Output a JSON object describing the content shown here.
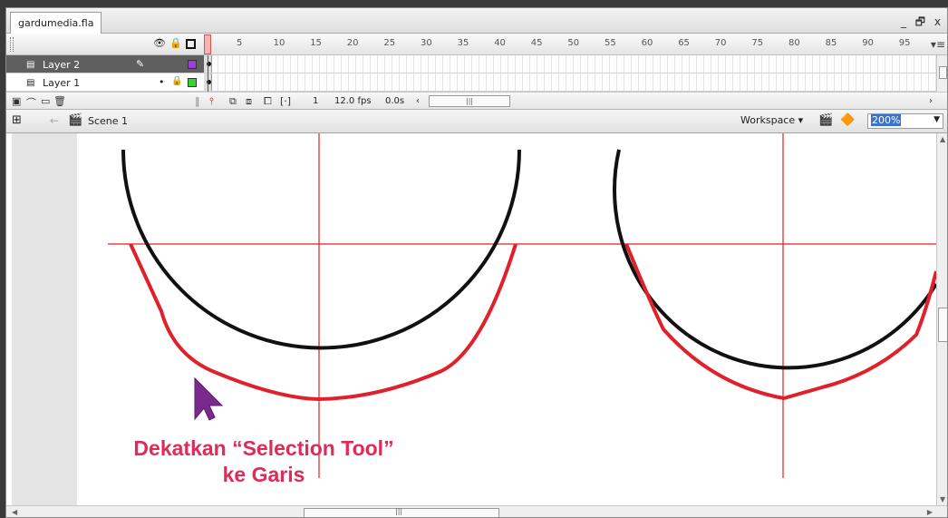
{
  "document": {
    "tab_label": "gardumedia.fla"
  },
  "window_controls": {
    "minimize": "_",
    "restore": "🗗",
    "close": "x"
  },
  "timeline": {
    "frame_numbers": [
      "5",
      "10",
      "15",
      "20",
      "25",
      "30",
      "35",
      "40",
      "45",
      "50",
      "55",
      "60",
      "65",
      "70",
      "75",
      "80",
      "85",
      "90",
      "95"
    ],
    "layers": [
      {
        "name": "Layer 2",
        "selected": true,
        "color": "#9b3fd6"
      },
      {
        "name": "Layer 1",
        "selected": false,
        "color": "#35d435"
      }
    ],
    "status": {
      "current_frame": "1",
      "frame_rate": "12.0 fps",
      "elapsed": "0.0s"
    }
  },
  "editbar": {
    "scene": "Scene 1",
    "workspace": "Workspace ▾",
    "zoom": "200%"
  },
  "stage": {
    "caption_line1": "Dekatkan “Selection Tool”",
    "caption_line2": "ke Garis",
    "colors": {
      "guide": "#e02020",
      "curve": "#e0202a",
      "circle": "#111111",
      "cursor": "#7a2a8a",
      "caption": "#e02a57"
    }
  }
}
